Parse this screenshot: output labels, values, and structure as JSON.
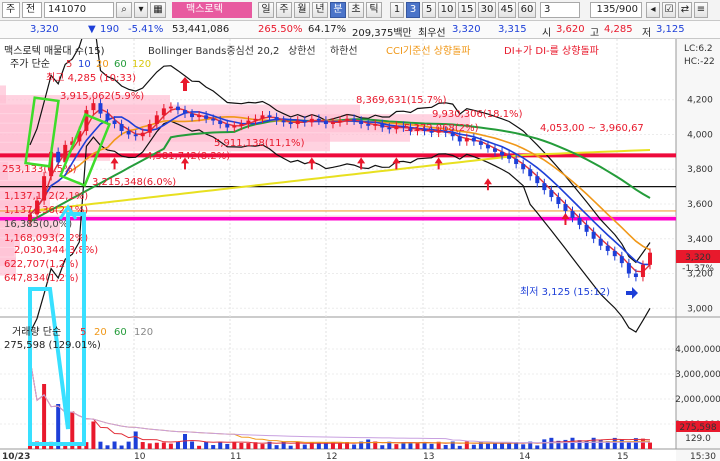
{
  "toolbar": {
    "period_select": "주",
    "code_prev": "전",
    "stock_code": "141070",
    "stock_name": "맥스로텍",
    "intervals": [
      "일",
      "주",
      "월",
      "년",
      "분",
      "초",
      "틱"
    ],
    "numbers": [
      "1",
      "3",
      "5",
      "10",
      "15",
      "30",
      "45",
      "60"
    ],
    "count": "3",
    "page": "135/900"
  },
  "quote": {
    "price": "3,320",
    "change": "190",
    "change_pct": "-5.41%",
    "volume": "53,441,086",
    "vol_ratio": "265.50%",
    "turnover": "64.17%",
    "amount": "209,375백만",
    "label_best_ask": "최우선",
    "ask": "3,320",
    "bid": "3,315",
    "label_high": "시",
    "open": "3,620",
    "label_low": "고",
    "high": "4,285",
    "label_low2": "저",
    "low": "3,125"
  },
  "legend": {
    "title": "맥스로텍 매물대 수(15)",
    "bollinger": "Bollinger Bands중심선 20,2",
    "upper": "상한선",
    "lower": "하한선",
    "cci": "CCI기준선 상향돌파",
    "di": "DI+가 DI-를 상향돌파",
    "lc": "LC:6.2",
    "hc": "HC:-22",
    "ma_label": "주가 단순",
    "ma_periods": [
      "5",
      "10",
      "20",
      "60",
      "120"
    ],
    "vol_label": "거래량 단순",
    "vol_periods": [
      "5",
      "20",
      "60",
      "120"
    ],
    "vol_value": "275,598 (129.01%)"
  },
  "price_axis": {
    "ticks": [
      "4,200",
      "4,000",
      "3,800",
      "3,600",
      "3,400",
      "3,200",
      "3,000"
    ],
    "current": "3,320",
    "current_pct": "-1.37%"
  },
  "volume_axis": {
    "ticks": [
      "4,000,000",
      "3,000,000",
      "2,000,000",
      "1,000,000"
    ],
    "current": "275,598",
    "ratio": "129.0"
  },
  "date_axis": [
    "10/23",
    "10",
    "11",
    "12",
    "13",
    "14",
    "15",
    "15:30"
  ],
  "annotations": {
    "high_label": "최고 4,285 (10:33)",
    "low_label": "최저 3,125 (15:12)",
    "levels": [
      "3,915,062(5.9%)",
      "8,369,631(15.7%)",
      "9,930,306(18.1%)",
      "5,372,068(2%)",
      "4,053,00 ~ 3,960,67",
      "4,581,742(8.2%)",
      "5,911,138(11,1%)",
      "253,133(0.5%)",
      "3,215,348(6.0%)",
      "1,137,172(2,1%)",
      "1,137,136(2,1%)",
      "16,385(0,0%)",
      "1,168,093(2,2%)",
      "2,030,344(3,8%)",
      "622,707(1,2%)",
      "647,834(1,2%)"
    ]
  },
  "colors": {
    "up": "#e8192c",
    "down": "#1d3fd8",
    "ma5": "#e2303a",
    "ma10": "#1d3fd8",
    "ma20": "#f09819",
    "ma60": "#249c3a",
    "ma120": "#e8e020",
    "band": "#111111",
    "pink_line": "#ff00cc",
    "red_line": "#ee0a3c",
    "profile": "#ffbfd3",
    "cyan": "#38e0ff",
    "green_box": "#3edc2a"
  }
}
